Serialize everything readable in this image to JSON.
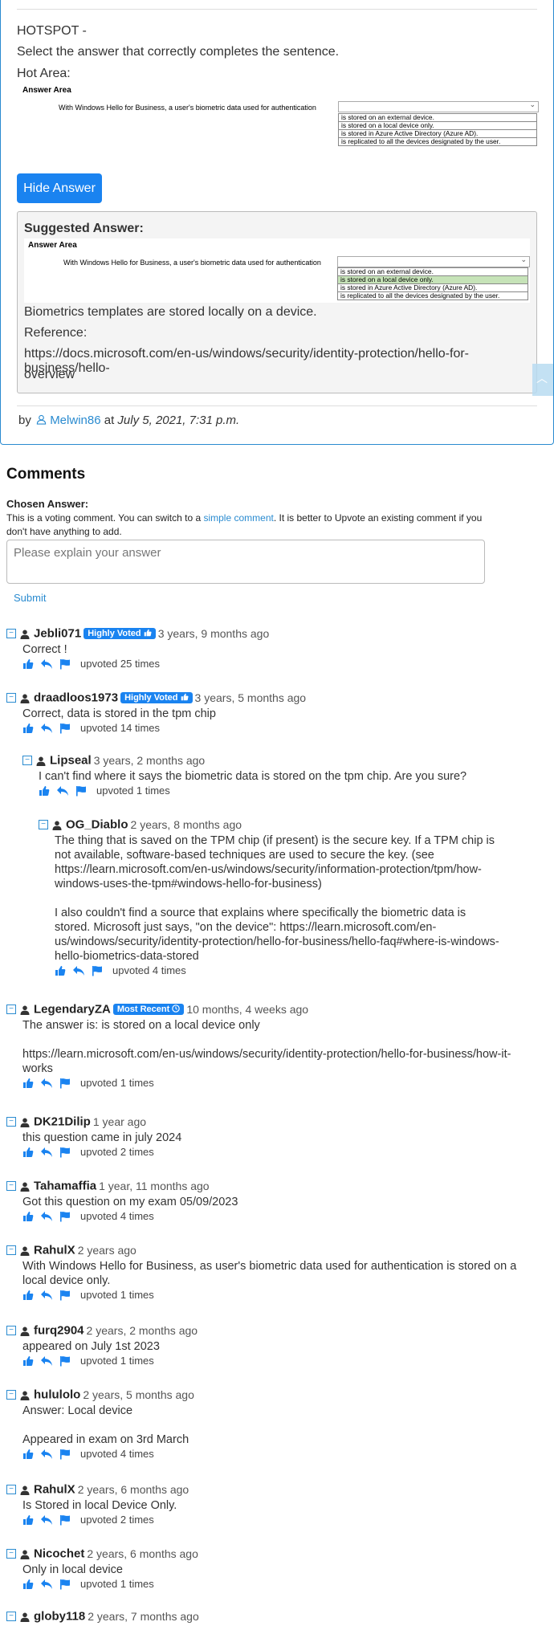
{
  "question": {
    "title": "HOTSPOT -",
    "prompt": "Select the answer that correctly completes the sentence.",
    "hot_area_label": "Hot Area:",
    "answer_area_title": "Answer Area",
    "stem": "With Windows Hello for Business, a user's biometric data used for authentication",
    "options": [
      "is stored on an external device.",
      "is stored on a local device only.",
      "is stored in Azure Active Directory (Azure AD).",
      "is replicated to all the devices designated by the user."
    ],
    "selected_index": 1,
    "selected_color": "#c6e3b8"
  },
  "hide_answer_label": "Hide Answer",
  "suggested": {
    "title": "Suggested Answer:",
    "explanation": "Biometrics templates are stored locally on a device.",
    "reference_label": "Reference:",
    "reference_url_line1": "https://docs.microsoft.com/en-us/windows/security/identity-protection/hello-for-business/hello-",
    "reference_url_line2": "overview"
  },
  "byline": {
    "prefix": "by",
    "user": "Melwin86",
    "at": "at",
    "date": "July 5, 2021, 7:31 p.m."
  },
  "comments_section": {
    "heading": "Comments",
    "chosen_answer": "Chosen Answer:",
    "note_part1": "This is a voting comment. You can switch to a ",
    "note_link": "simple comment",
    "note_part2": ". It is better to Upvote an existing comment if you don't have anything to add.",
    "placeholder": "Please explain your answer",
    "submit": "Submit"
  },
  "accent_color": "#1a83f0",
  "comments": [
    {
      "user": "Jebli071",
      "badge": "Highly Voted",
      "ago": "3 years, 9 months ago",
      "body": "Correct !",
      "upvotes": "upvoted 25 times"
    },
    {
      "user": "draadloos1973",
      "badge": "Highly Voted",
      "ago": "3 years, 5 months ago",
      "body": "Correct, data is stored in the tpm chip",
      "upvotes": "upvoted 14 times"
    },
    {
      "user": "Lipseal",
      "badge": "",
      "ago": "3 years, 2 months ago",
      "body": "I can't find where it says the biometric data is stored on the tpm chip. Are you sure?",
      "upvotes": "upvoted 1 times"
    },
    {
      "user": "OG_Diablo",
      "badge": "",
      "ago": "2 years, 8 months ago",
      "body": "The thing that is saved on the TPM chip (if present) is the secure key. If a TPM chip is not available, software-based techniques are used to secure the key. (see https://learn.microsoft.com/en-us/windows/security/information-protection/tpm/how-windows-uses-the-tpm#windows-hello-for-business)\n\nI also couldn't find a source that explains where specifically the biometric data is stored. Microsoft just says, \"on the device\": https://learn.microsoft.com/en-us/windows/security/identity-protection/hello-for-business/hello-faq#where-is-windows-hello-biometrics-data-stored",
      "upvotes": "upvoted 4 times"
    },
    {
      "user": "LegendaryZA",
      "badge": "Most Recent",
      "ago": "10 months, 4 weeks ago",
      "body": "The answer is: is stored on a local device only\n\nhttps://learn.microsoft.com/en-us/windows/security/identity-protection/hello-for-business/how-it-works",
      "upvotes": "upvoted 1 times"
    },
    {
      "user": "DK21Dilip",
      "badge": "",
      "ago": "1 year ago",
      "body": "this question came in july 2024",
      "upvotes": "upvoted 2 times"
    },
    {
      "user": "Tahamaffia",
      "badge": "",
      "ago": "1 year, 11 months ago",
      "body": "Got this question on my exam 05/09/2023",
      "upvotes": "upvoted 4 times"
    },
    {
      "user": "RahulX",
      "badge": "",
      "ago": "2 years ago",
      "body": "With Windows Hello for Business, as user's biometric data used for authentication is stored on a local device only.",
      "upvotes": "upvoted 1 times"
    },
    {
      "user": "furq2904",
      "badge": "",
      "ago": "2 years, 2 months ago",
      "body": "appeared on July 1st 2023",
      "upvotes": "upvoted 1 times"
    },
    {
      "user": "hululolo",
      "badge": "",
      "ago": "2 years, 5 months ago",
      "body": "Answer: Local device\n\nAppeared in exam on 3rd March",
      "upvotes": "upvoted 4 times"
    },
    {
      "user": "RahulX",
      "badge": "",
      "ago": "2 years, 6 months ago",
      "body": "Is Stored in local Device Only.",
      "upvotes": "upvoted 2 times"
    },
    {
      "user": "Nicochet",
      "badge": "",
      "ago": "2 years, 6 months ago",
      "body": "Only in local device",
      "upvotes": "upvoted 1 times"
    },
    {
      "user": "globy118",
      "badge": "",
      "ago": "2 years, 7 months ago",
      "body": "",
      "upvotes": ""
    }
  ]
}
